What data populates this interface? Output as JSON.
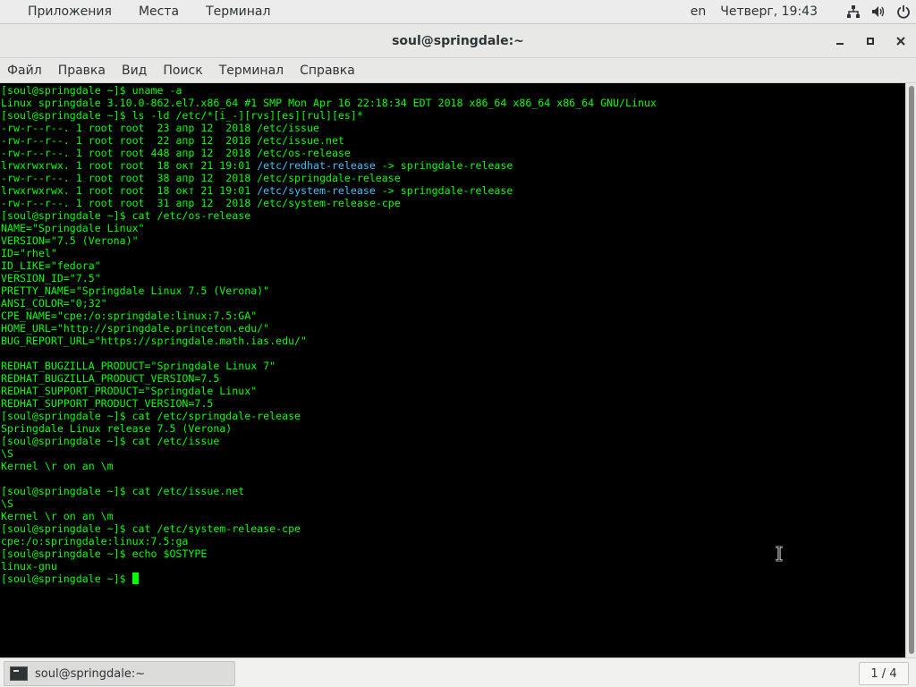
{
  "top_panel": {
    "menus": [
      "Приложения",
      "Места",
      "Терминал"
    ],
    "language": "en",
    "clock": "Четверг, 19:43",
    "tray_icons": [
      "network-icon",
      "volume-icon",
      "power-icon"
    ]
  },
  "window": {
    "title": "soul@springdale:~"
  },
  "menubar": {
    "items": [
      "Файл",
      "Правка",
      "Вид",
      "Поиск",
      "Терминал",
      "Справка"
    ]
  },
  "terminal": {
    "colors": {
      "text": "#00ff00",
      "link": "#39c3ff",
      "background": "#000000"
    },
    "lines": [
      [
        "[soul@springdale ~]$ uname -a"
      ],
      [
        "Linux springdale 3.10.0-862.el7.x86_64 #1 SMP Mon Apr 16 22:18:34 EDT 2018 x86_64 x86_64 x86_64 GNU/Linux"
      ],
      [
        "[soul@springdale ~]$ ls -ld /etc/*[i_-][rvs][es][rul][es]*"
      ],
      [
        "-rw-r--r--. 1 root root  23 апр 12  2018 /etc/issue"
      ],
      [
        "-rw-r--r--. 1 root root  22 апр 12  2018 /etc/issue.net"
      ],
      [
        "-rw-r--r--. 1 root root 448 апр 12  2018 /etc/os-release"
      ],
      [
        "lrwxrwxrwx. 1 root root  18 окт 21 19:01 ",
        "/etc/redhat-release",
        " -> springdale-release"
      ],
      [
        "-rw-r--r--. 1 root root  38 апр 12  2018 /etc/springdale-release"
      ],
      [
        "lrwxrwxrwx. 1 root root  18 окт 21 19:01 ",
        "/etc/system-release",
        " -> springdale-release"
      ],
      [
        "-rw-r--r--. 1 root root  31 апр 12  2018 /etc/system-release-cpe"
      ],
      [
        "[soul@springdale ~]$ cat /etc/os-release"
      ],
      [
        "NAME=\"Springdale Linux\""
      ],
      [
        "VERSION=\"7.5 (Verona)\""
      ],
      [
        "ID=\"rhel\""
      ],
      [
        "ID_LIKE=\"fedora\""
      ],
      [
        "VERSION_ID=\"7.5\""
      ],
      [
        "PRETTY_NAME=\"Springdale Linux 7.5 (Verona)\""
      ],
      [
        "ANSI_COLOR=\"0;32\""
      ],
      [
        "CPE_NAME=\"cpe:/o:springdale:linux:7.5:GA\""
      ],
      [
        "HOME_URL=\"http://springdale.princeton.edu/\""
      ],
      [
        "BUG_REPORT_URL=\"https://springdale.math.ias.edu/\""
      ],
      [
        ""
      ],
      [
        "REDHAT_BUGZILLA_PRODUCT=\"Springdale Linux 7\""
      ],
      [
        "REDHAT_BUGZILLA_PRODUCT_VERSION=7.5"
      ],
      [
        "REDHAT_SUPPORT_PRODUCT=\"Springdale Linux\""
      ],
      [
        "REDHAT_SUPPORT_PRODUCT_VERSION=7.5"
      ],
      [
        "[soul@springdale ~]$ cat /etc/springdale-release"
      ],
      [
        "Springdale Linux release 7.5 (Verona)"
      ],
      [
        "[soul@springdale ~]$ cat /etc/issue"
      ],
      [
        "\\S"
      ],
      [
        "Kernel \\r on an \\m"
      ],
      [
        ""
      ],
      [
        "[soul@springdale ~]$ cat /etc/issue.net"
      ],
      [
        "\\S"
      ],
      [
        "Kernel \\r on an \\m"
      ],
      [
        "[soul@springdale ~]$ cat /etc/system-release-cpe"
      ],
      [
        "cpe:/o:springdale:linux:7.5:ga"
      ],
      [
        "[soul@springdale ~]$ echo $OSTYPE"
      ],
      [
        "linux-gnu"
      ]
    ],
    "prompt": "[soul@springdale ~]$ "
  },
  "taskbar": {
    "task_label": "soul@springdale:~",
    "workspace": "1 / 4"
  }
}
